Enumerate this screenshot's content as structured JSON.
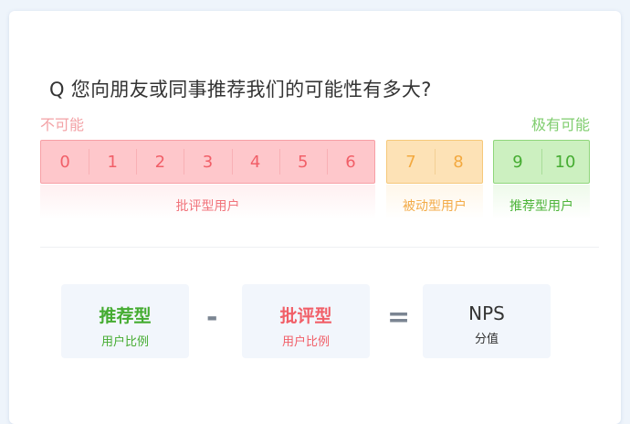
{
  "question": "Q 您向朋友或同事推荐我们的可能性有多大?",
  "scale": {
    "low_label": "不可能",
    "high_label": "极有可能"
  },
  "groups": [
    {
      "scores": [
        "0",
        "1",
        "2",
        "3",
        "4",
        "5",
        "6"
      ],
      "label": "批评型用户",
      "color": "#f15f68"
    },
    {
      "scores": [
        "7",
        "8"
      ],
      "label": "被动型用户",
      "color": "#f3a93f"
    },
    {
      "scores": [
        "9",
        "10"
      ],
      "label": "推荐型用户",
      "color": "#45ac31"
    }
  ],
  "formula": {
    "promoter": {
      "title": "推荐型",
      "sub": "用户比例"
    },
    "minus": "-",
    "detractor": {
      "title": "批评型",
      "sub": "用户比例"
    },
    "equals": "=",
    "result": {
      "title": "NPS",
      "sub": "分值"
    }
  }
}
